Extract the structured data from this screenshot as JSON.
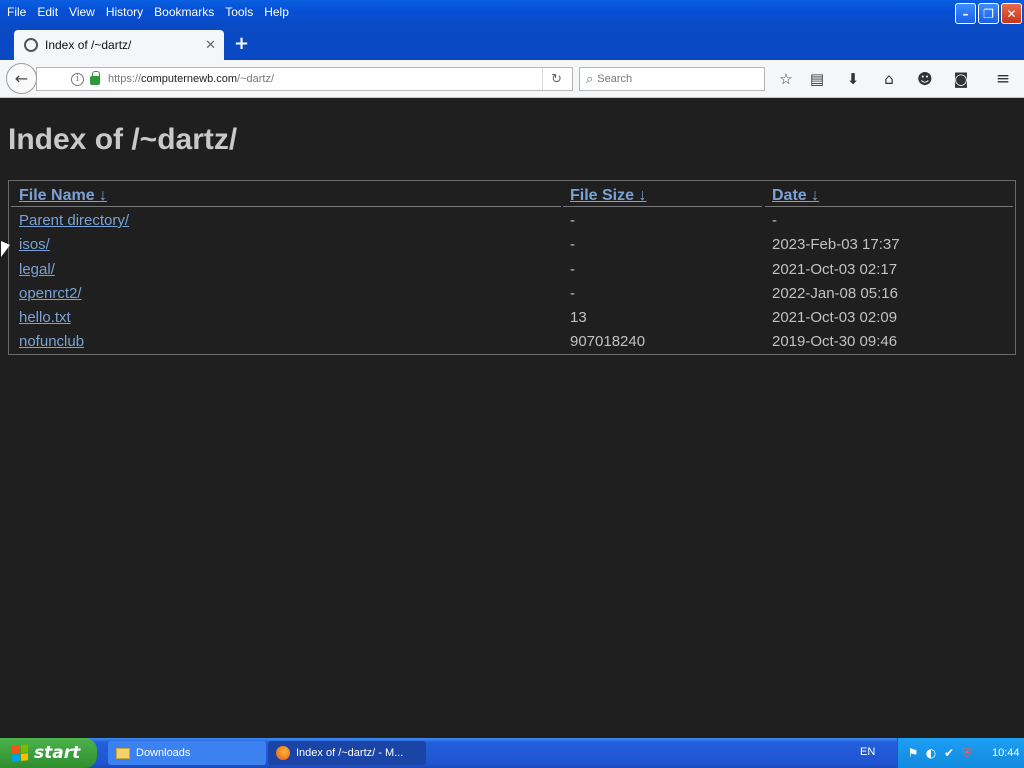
{
  "menubar": {
    "items": [
      "File",
      "Edit",
      "View",
      "History",
      "Bookmarks",
      "Tools",
      "Help"
    ]
  },
  "window_controls": {
    "minimize": "–",
    "maximize": "❐",
    "close": "✕"
  },
  "tab": {
    "title": "Index of /~dartz/",
    "close": "✕",
    "new_tab": "+"
  },
  "navbar": {
    "url_scheme": "https://",
    "url_host": "computernewb.com",
    "url_path": "/~dartz/",
    "search_placeholder": "Search"
  },
  "page": {
    "title": "Index of /~dartz/",
    "headers": {
      "name": "File Name  ↓",
      "size": "File Size  ↓",
      "date": "Date  ↓"
    },
    "rows": [
      {
        "name": "Parent directory/",
        "size": "-",
        "date": "-"
      },
      {
        "name": "isos/",
        "size": "-",
        "date": "2023-Feb-03 17:37"
      },
      {
        "name": "legal/",
        "size": "-",
        "date": "2021-Oct-03 02:17"
      },
      {
        "name": "openrct2/",
        "size": "-",
        "date": "2022-Jan-08 05:16"
      },
      {
        "name": "hello.txt",
        "size": "13",
        "date": "2021-Oct-03 02:09"
      },
      {
        "name": "nofunclub",
        "size": "907018240",
        "date": "2019-Oct-30 09:46"
      }
    ]
  },
  "taskbar": {
    "start_label": "start",
    "tasks": [
      "Downloads",
      "Index of /~dartz/ - M..."
    ],
    "language": "EN",
    "clock": "10:44"
  },
  "colors": {
    "page_background": "#1f1f1f",
    "link": "#7aa2d6",
    "title": "#c9c9c9",
    "xp_blue": "#0a49c4"
  }
}
